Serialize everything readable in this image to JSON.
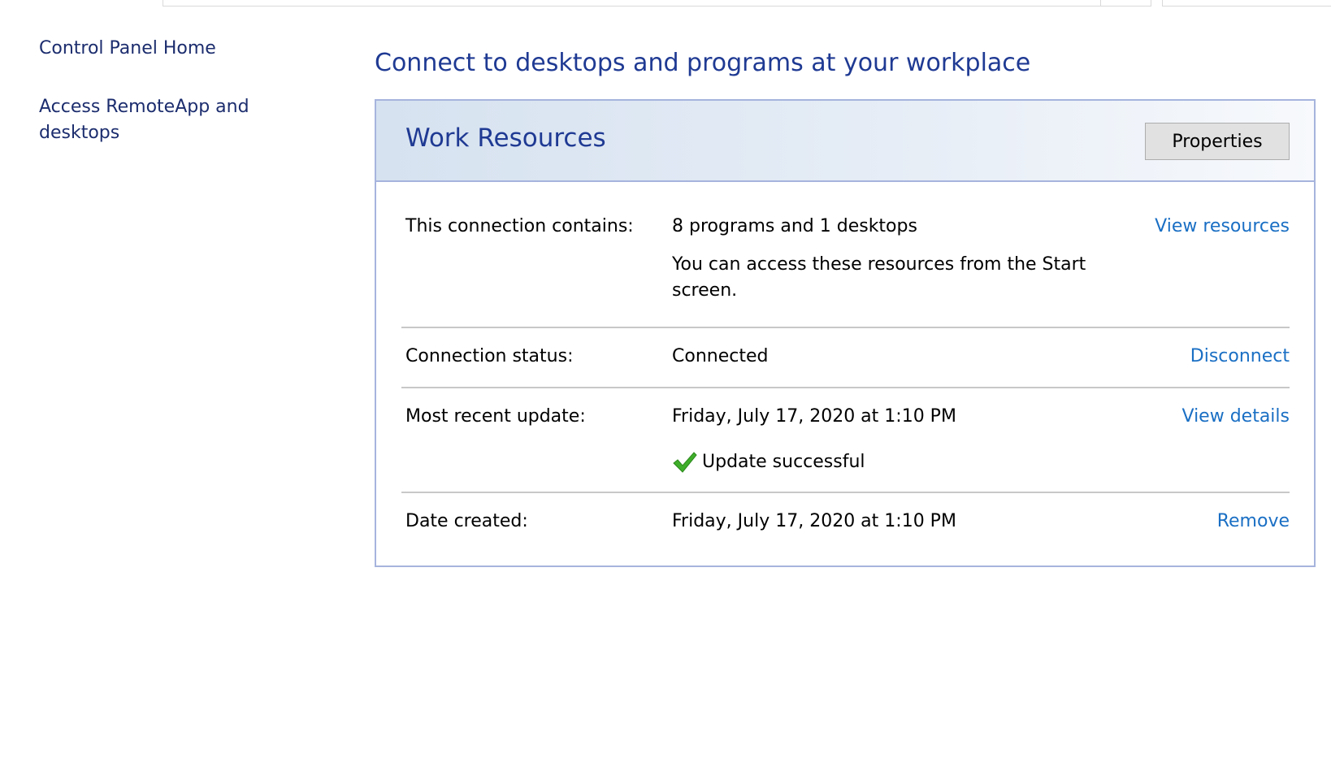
{
  "sidebar": {
    "home_link": "Control Panel Home",
    "remoteapp_link_line1": "Access RemoteApp and",
    "remoteapp_link_line2": "desktops"
  },
  "main": {
    "title": "Connect to desktops and programs at your workplace"
  },
  "panel": {
    "title": "Work Resources",
    "properties_button": "Properties",
    "rows": [
      {
        "label": "This connection contains:",
        "value": "8 programs and 1 desktops",
        "note": "You can access these resources from the Start screen.",
        "action": "View resources"
      },
      {
        "label": "Connection status:",
        "value": "Connected",
        "action": "Disconnect"
      },
      {
        "label": "Most recent update:",
        "value": "Friday, July 17, 2020 at 1:10 PM",
        "status": "Update successful",
        "action": "View details"
      },
      {
        "label": "Date created:",
        "value": "Friday, July 17, 2020 at 1:10 PM",
        "action": "Remove"
      }
    ]
  },
  "colors": {
    "link": "#1a6fc4",
    "heading": "#1f3a93",
    "nav": "#1c2d6e",
    "panel_border": "#a6b4dd",
    "success": "#3fae2a"
  },
  "icons": {
    "status_icon": "green-checkmark-icon"
  }
}
